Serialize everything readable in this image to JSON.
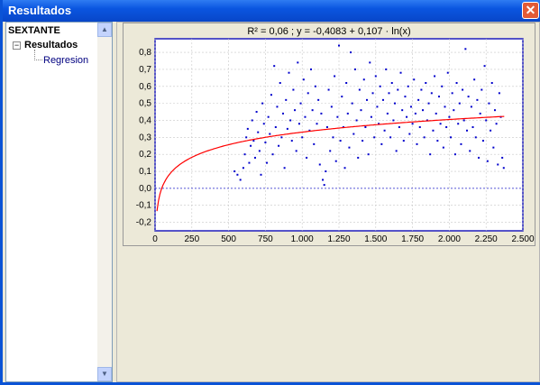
{
  "window": {
    "title": "Resultados",
    "close_icon": "close-icon"
  },
  "tree": {
    "root": "SEXTANTE",
    "expander": "−",
    "node": "Resultados",
    "leaf": "Regresion"
  },
  "scrollbar": {
    "up_icon": "▲",
    "down_icon": "▼"
  },
  "chart_data": {
    "type": "scatter",
    "title": "R² = 0,06 ;  y = -0,4083 + 0,107 · ln(x)",
    "xlabel": "",
    "ylabel": "",
    "xlim": [
      0,
      2500
    ],
    "ylim": [
      -0.25,
      0.88
    ],
    "x_ticks": [
      0,
      250,
      500,
      750,
      1000,
      1250,
      1500,
      1750,
      2000,
      2250,
      2500
    ],
    "x_tick_labels": [
      "0",
      "250",
      "500",
      "750",
      "1.000",
      "1.250",
      "1.500",
      "1.750",
      "2.000",
      "2.250",
      "2.500"
    ],
    "y_ticks": [
      -0.2,
      -0.1,
      0.0,
      0.1,
      0.2,
      0.3,
      0.4,
      0.5,
      0.6,
      0.7,
      0.8
    ],
    "y_tick_labels": [
      "-0,2",
      "-0,1",
      "0,0",
      "0,1",
      "0,2",
      "0,3",
      "0,4",
      "0,5",
      "0,6",
      "0,7",
      "0,8"
    ],
    "grid": true,
    "series": [
      {
        "color": "#0000cc",
        "points": [
          [
            540,
            0.1
          ],
          [
            560,
            0.08
          ],
          [
            580,
            0.05
          ],
          [
            600,
            0.12
          ],
          [
            610,
            0.2
          ],
          [
            620,
            0.3
          ],
          [
            630,
            0.35
          ],
          [
            640,
            0.15
          ],
          [
            650,
            0.25
          ],
          [
            660,
            0.4
          ],
          [
            670,
            0.28
          ],
          [
            680,
            0.18
          ],
          [
            690,
            0.45
          ],
          [
            700,
            0.33
          ],
          [
            710,
            0.22
          ],
          [
            720,
            0.08
          ],
          [
            730,
            0.5
          ],
          [
            740,
            0.38
          ],
          [
            750,
            0.27
          ],
          [
            760,
            0.15
          ],
          [
            770,
            0.42
          ],
          [
            780,
            0.32
          ],
          [
            790,
            0.55
          ],
          [
            800,
            0.2
          ],
          [
            810,
            0.72
          ],
          [
            820,
            0.36
          ],
          [
            830,
            0.48
          ],
          [
            840,
            0.25
          ],
          [
            850,
            0.62
          ],
          [
            860,
            0.3
          ],
          [
            870,
            0.44
          ],
          [
            880,
            0.12
          ],
          [
            890,
            0.52
          ],
          [
            900,
            0.35
          ],
          [
            910,
            0.68
          ],
          [
            920,
            0.4
          ],
          [
            930,
            0.28
          ],
          [
            940,
            0.58
          ],
          [
            950,
            0.46
          ],
          [
            960,
            0.22
          ],
          [
            970,
            0.74
          ],
          [
            980,
            0.38
          ],
          [
            990,
            0.5
          ],
          [
            1000,
            0.3
          ],
          [
            1010,
            0.64
          ],
          [
            1020,
            0.42
          ],
          [
            1030,
            0.18
          ],
          [
            1040,
            0.56
          ],
          [
            1050,
            0.34
          ],
          [
            1060,
            0.7
          ],
          [
            1070,
            0.46
          ],
          [
            1080,
            0.26
          ],
          [
            1090,
            0.6
          ],
          [
            1100,
            0.38
          ],
          [
            1110,
            0.52
          ],
          [
            1120,
            0.14
          ],
          [
            1130,
            0.44
          ],
          [
            1140,
            0.05
          ],
          [
            1150,
            0.02
          ],
          [
            1160,
            0.1
          ],
          [
            1170,
            0.36
          ],
          [
            1180,
            0.58
          ],
          [
            1190,
            0.22
          ],
          [
            1200,
            0.48
          ],
          [
            1210,
            0.3
          ],
          [
            1220,
            0.66
          ],
          [
            1230,
            0.16
          ],
          [
            1240,
            0.42
          ],
          [
            1250,
            0.84
          ],
          [
            1260,
            0.28
          ],
          [
            1270,
            0.54
          ],
          [
            1280,
            0.36
          ],
          [
            1290,
            0.12
          ],
          [
            1300,
            0.62
          ],
          [
            1310,
            0.44
          ],
          [
            1320,
            0.24
          ],
          [
            1330,
            0.8
          ],
          [
            1340,
            0.5
          ],
          [
            1350,
            0.32
          ],
          [
            1360,
            0.7
          ],
          [
            1370,
            0.4
          ],
          [
            1380,
            0.18
          ],
          [
            1390,
            0.58
          ],
          [
            1400,
            0.46
          ],
          [
            1410,
            0.28
          ],
          [
            1420,
            0.64
          ],
          [
            1430,
            0.36
          ],
          [
            1440,
            0.52
          ],
          [
            1450,
            0.2
          ],
          [
            1460,
            0.74
          ],
          [
            1470,
            0.42
          ],
          [
            1480,
            0.56
          ],
          [
            1490,
            0.3
          ],
          [
            1500,
            0.66
          ],
          [
            1510,
            0.48
          ],
          [
            1520,
            0.38
          ],
          [
            1530,
            0.6
          ],
          [
            1540,
            0.26
          ],
          [
            1550,
            0.52
          ],
          [
            1560,
            0.34
          ],
          [
            1570,
            0.7
          ],
          [
            1580,
            0.44
          ],
          [
            1590,
            0.56
          ],
          [
            1600,
            0.3
          ],
          [
            1610,
            0.62
          ],
          [
            1620,
            0.4
          ],
          [
            1630,
            0.5
          ],
          [
            1640,
            0.22
          ],
          [
            1650,
            0.58
          ],
          [
            1660,
            0.36
          ],
          [
            1670,
            0.68
          ],
          [
            1680,
            0.46
          ],
          [
            1690,
            0.28
          ],
          [
            1700,
            0.54
          ],
          [
            1710,
            0.42
          ],
          [
            1720,
            0.6
          ],
          [
            1730,
            0.32
          ],
          [
            1740,
            0.48
          ],
          [
            1750,
            0.38
          ],
          [
            1760,
            0.64
          ],
          [
            1770,
            0.44
          ],
          [
            1780,
            0.26
          ],
          [
            1790,
            0.52
          ],
          [
            1800,
            0.36
          ],
          [
            1810,
            0.58
          ],
          [
            1820,
            0.46
          ],
          [
            1830,
            0.3
          ],
          [
            1840,
            0.62
          ],
          [
            1850,
            0.4
          ],
          [
            1860,
            0.5
          ],
          [
            1870,
            0.2
          ],
          [
            1880,
            0.56
          ],
          [
            1890,
            0.34
          ],
          [
            1900,
            0.66
          ],
          [
            1910,
            0.44
          ],
          [
            1920,
            0.28
          ],
          [
            1930,
            0.54
          ],
          [
            1940,
            0.38
          ],
          [
            1950,
            0.6
          ],
          [
            1960,
            0.24
          ],
          [
            1970,
            0.48
          ],
          [
            1980,
            0.36
          ],
          [
            1990,
            0.68
          ],
          [
            2000,
            0.42
          ],
          [
            2010,
            0.3
          ],
          [
            2020,
            0.56
          ],
          [
            2030,
            0.46
          ],
          [
            2040,
            0.2
          ],
          [
            2050,
            0.62
          ],
          [
            2060,
            0.38
          ],
          [
            2070,
            0.5
          ],
          [
            2080,
            0.26
          ],
          [
            2090,
            0.58
          ],
          [
            2100,
            0.4
          ],
          [
            2110,
            0.82
          ],
          [
            2120,
            0.34
          ],
          [
            2130,
            0.54
          ],
          [
            2140,
            0.22
          ],
          [
            2150,
            0.48
          ],
          [
            2160,
            0.36
          ],
          [
            2170,
            0.64
          ],
          [
            2180,
            0.3
          ],
          [
            2190,
            0.52
          ],
          [
            2200,
            0.18
          ],
          [
            2210,
            0.44
          ],
          [
            2220,
            0.58
          ],
          [
            2230,
            0.28
          ],
          [
            2240,
            0.72
          ],
          [
            2250,
            0.4
          ],
          [
            2260,
            0.16
          ],
          [
            2270,
            0.5
          ],
          [
            2280,
            0.34
          ],
          [
            2290,
            0.62
          ],
          [
            2300,
            0.24
          ],
          [
            2310,
            0.46
          ],
          [
            2320,
            0.38
          ],
          [
            2330,
            0.14
          ],
          [
            2340,
            0.56
          ],
          [
            2350,
            0.42
          ],
          [
            2360,
            0.18
          ],
          [
            2370,
            0.12
          ]
        ]
      },
      {
        "color": "#ff0000",
        "equation": "y = -0,4083 + 0,107 · ln(x)",
        "coefficients": {
          "a": -0.4083,
          "b": 0.107
        }
      }
    ]
  }
}
